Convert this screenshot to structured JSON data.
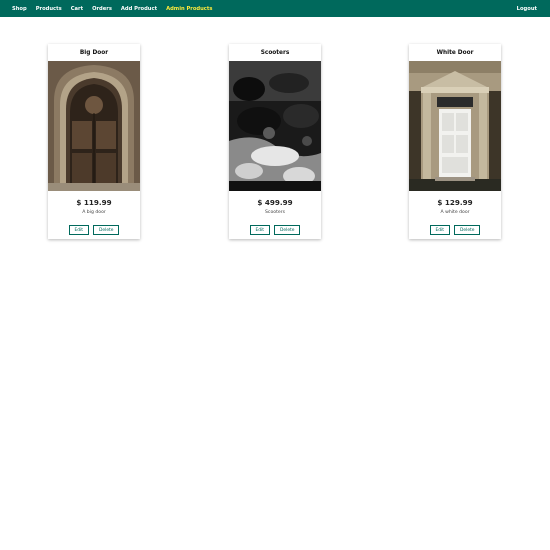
{
  "nav": {
    "links": [
      "Shop",
      "Products",
      "Cart",
      "Orders",
      "Add Product",
      "Admin Products"
    ],
    "active": "Admin Products",
    "logout": "Logout"
  },
  "products": [
    {
      "title": "Big Door",
      "price": "$ 119.99",
      "description": "A big door",
      "image": "arched-wooden-door-photo"
    },
    {
      "title": "Scooters",
      "price": "$ 499.99",
      "description": "Scooters",
      "image": "parked-scooters-photo"
    },
    {
      "title": "White Door",
      "price": "$ 129.99",
      "description": "A white door",
      "image": "white-front-door-photo"
    }
  ],
  "buttons": {
    "edit": "Edit",
    "delete": "Delete"
  },
  "colors": {
    "nav_bg": "#00695c",
    "active_link": "#ffeb3b",
    "button": "#00695c"
  }
}
